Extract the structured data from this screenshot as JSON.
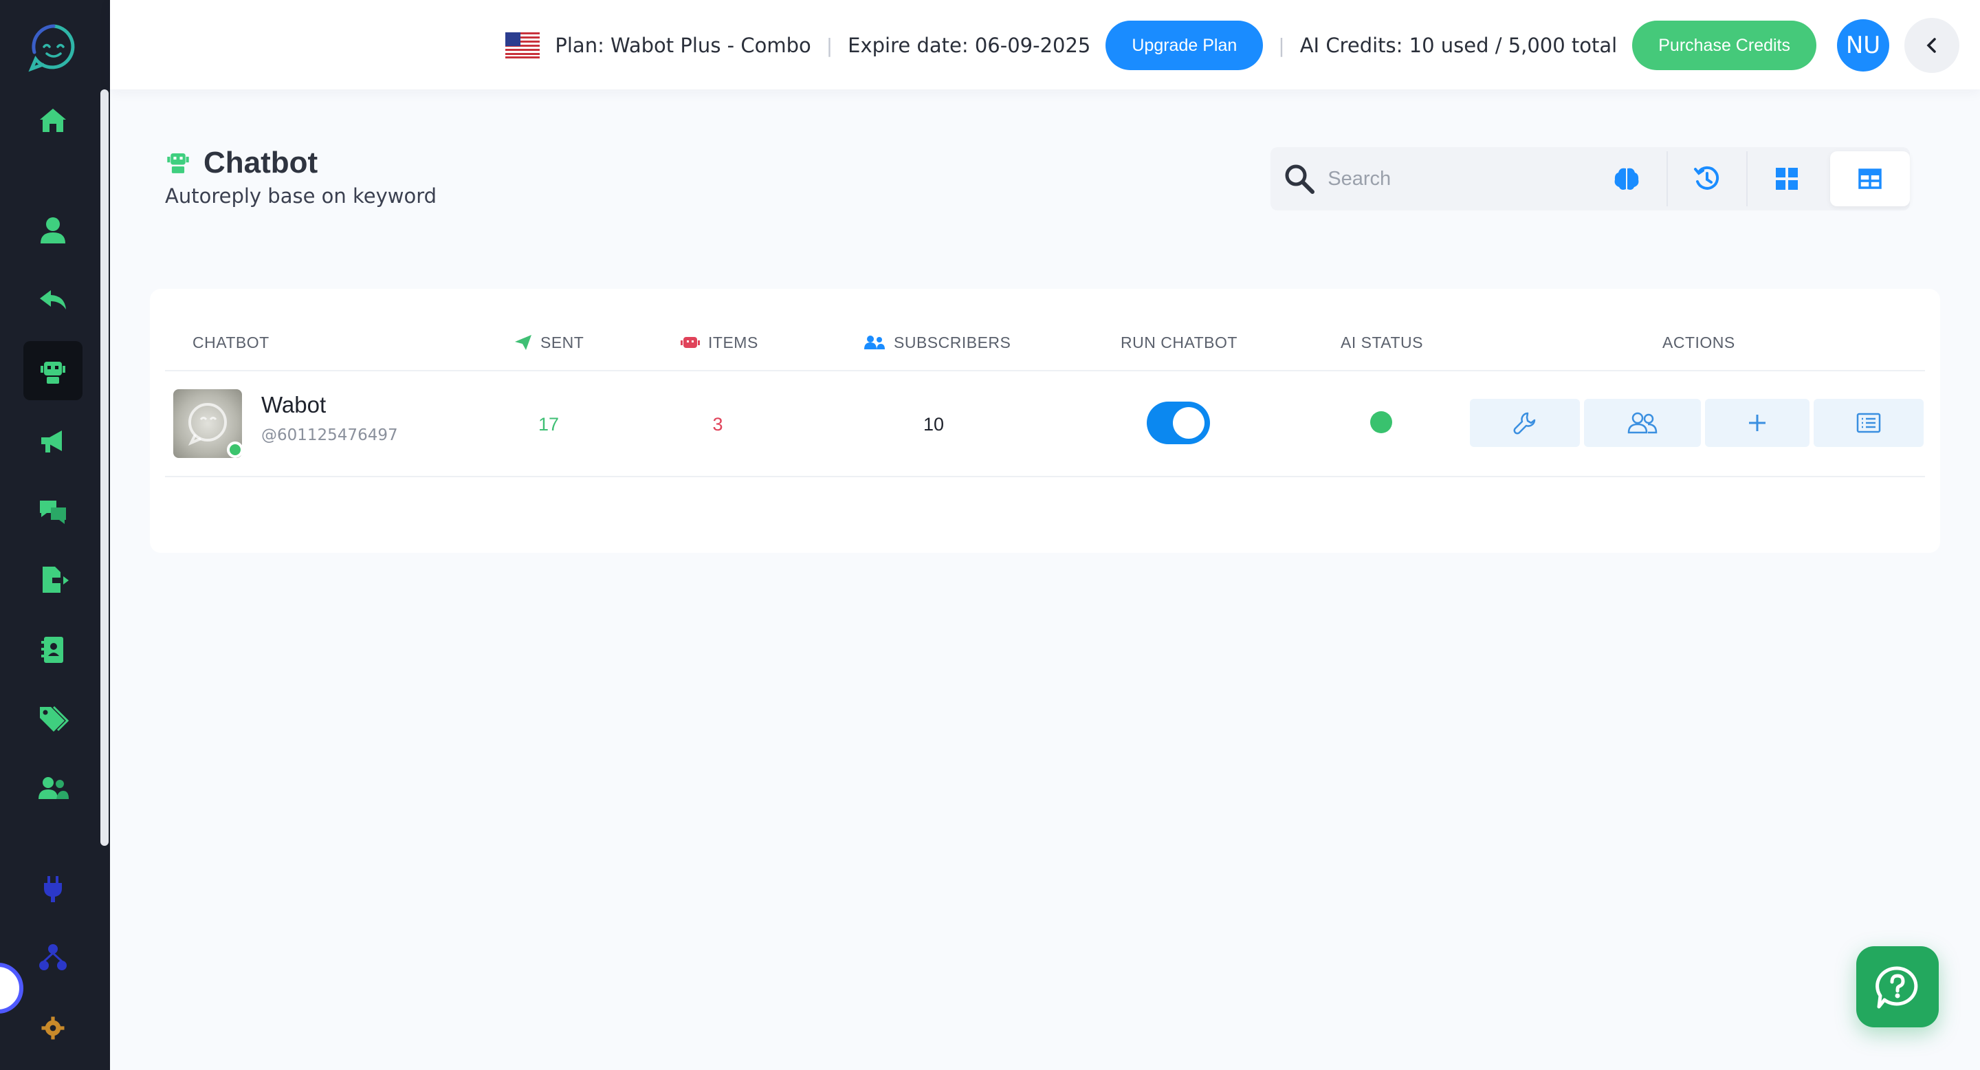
{
  "header": {
    "plan_text": "Plan: Wabot Plus - Combo",
    "separator": "|",
    "expire_text": "Expire date: 06-09-2025",
    "upgrade_label": "Upgrade Plan",
    "credits_text": "AI Credits: 10 used / 5,000 total",
    "purchase_label": "Purchase Credits",
    "avatar_initials": "NU"
  },
  "page": {
    "title": "Chatbot",
    "subtitle": "Autoreply base on keyword"
  },
  "search": {
    "placeholder": "Search"
  },
  "table": {
    "headers": {
      "chatbot": "CHATBOT",
      "sent": "SENT",
      "items": "ITEMS",
      "subscribers": "SUBSCRIBERS",
      "run_chatbot": "RUN CHATBOT",
      "ai_status": "AI STATUS",
      "actions": "ACTIONS"
    },
    "rows": [
      {
        "name": "Wabot",
        "handle": "@601125476497",
        "sent": "17",
        "items": "3",
        "subscribers": "10",
        "run_chatbot": true,
        "ai_status": "active"
      }
    ]
  },
  "icons": {
    "sidebar": [
      "home-icon",
      "user-icon",
      "reply-icon",
      "robot-icon",
      "megaphone-icon",
      "chat-icon",
      "export-icon",
      "contact-book-icon",
      "tag-icon",
      "users-icon",
      "plug-icon",
      "sitemap-icon",
      "gear-icon"
    ],
    "toolbar": [
      "search-icon",
      "brain-icon",
      "history-icon",
      "grid-icon",
      "table-icon"
    ],
    "actions": [
      "wrench-icon",
      "users-icon",
      "plus-icon",
      "list-icon"
    ]
  },
  "colors": {
    "accent_blue": "#1a8cff",
    "accent_green": "#45c97a",
    "sidebar_bg": "#1b1f2a",
    "sent_color": "#3fbf74",
    "items_color": "#e0435a",
    "status_active": "#39c26e"
  }
}
